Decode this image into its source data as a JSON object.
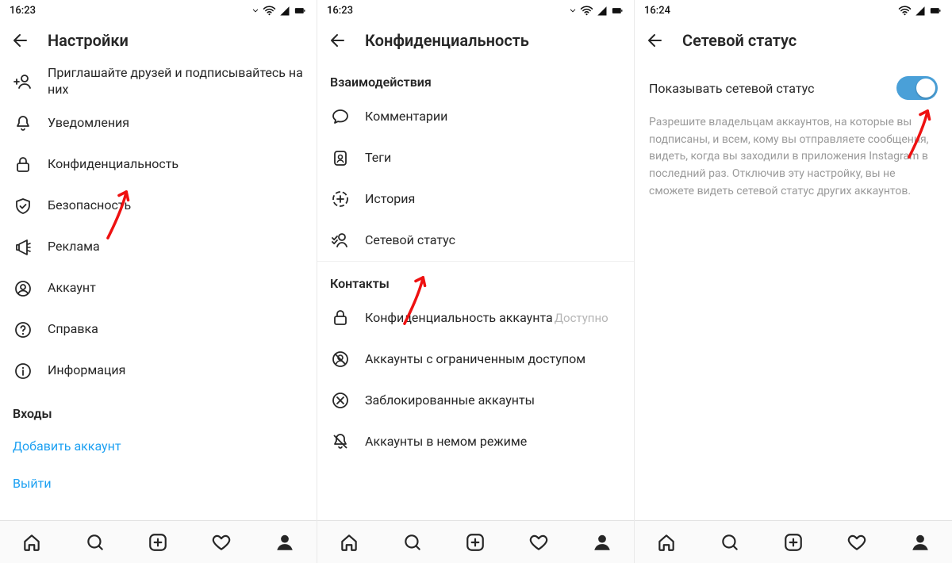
{
  "screen1": {
    "status_time": "16:23",
    "title": "Настройки",
    "items": [
      {
        "icon": "add-user-icon",
        "label": "Приглашайте друзей и подписывайтесь на них"
      },
      {
        "icon": "bell-icon",
        "label": "Уведомления"
      },
      {
        "icon": "lock-icon",
        "label": "Конфиденциальность"
      },
      {
        "icon": "shield-icon",
        "label": "Безопасность"
      },
      {
        "icon": "megaphone-icon",
        "label": "Реклама"
      },
      {
        "icon": "account-icon",
        "label": "Аккаунт"
      },
      {
        "icon": "help-icon",
        "label": "Справка"
      },
      {
        "icon": "info-icon",
        "label": "Информация"
      }
    ],
    "section": "Входы",
    "add_account": "Добавить аккаунт",
    "logout": "Выйти"
  },
  "screen2": {
    "status_time": "16:23",
    "title": "Конфиденциальность",
    "section1": "Взаимодействия",
    "items1": [
      {
        "icon": "comment-icon",
        "label": "Комментарии"
      },
      {
        "icon": "tag-icon",
        "label": "Теги"
      },
      {
        "icon": "story-icon",
        "label": "История"
      },
      {
        "icon": "activity-icon",
        "label": "Сетевой статус"
      }
    ],
    "section2": "Контакты",
    "items2": [
      {
        "icon": "lock-icon",
        "label": "Конфиденциальность аккаунта",
        "sub": "Доступно"
      },
      {
        "icon": "restricted-icon",
        "label": "Аккаунты с ограниченным доступом"
      },
      {
        "icon": "blocked-icon",
        "label": "Заблокированные аккаунты"
      },
      {
        "icon": "muted-icon",
        "label": "Аккаунты в немом режиме"
      }
    ]
  },
  "screen3": {
    "status_time": "16:24",
    "title": "Сетевой статус",
    "toggle_label": "Показывать сетевой статус",
    "toggle_on": true,
    "description": "Разрешите владельцам аккаунтов, на которые вы подписаны, и всем, кому вы отправляете сообщения, видеть, когда вы заходили в приложения Instagram в последний раз. Отключив эту настройку, вы не сможете видеть сетевой статус других аккаунтов."
  }
}
